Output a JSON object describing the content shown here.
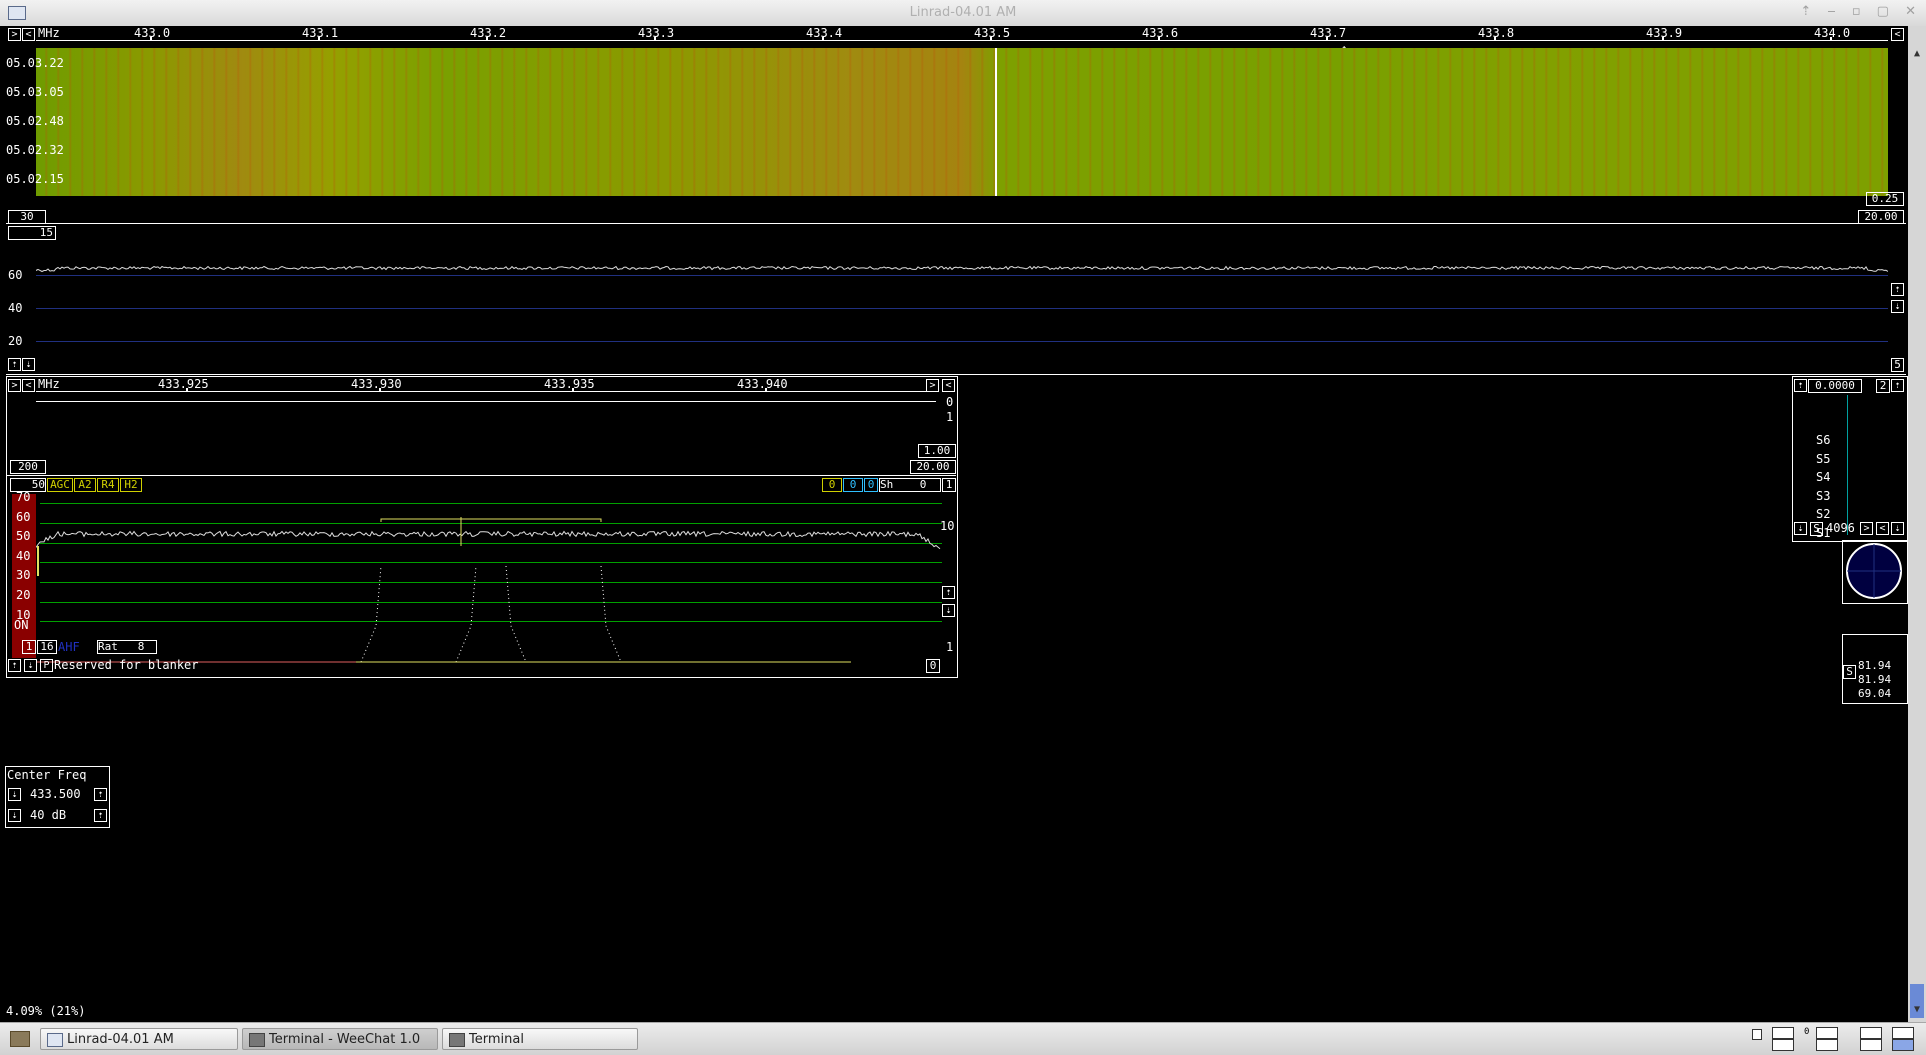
{
  "window": {
    "title": "Linrad-04.01 AM"
  },
  "top_axis": {
    "unit": "MHz",
    "ticks": [
      "433.0",
      "433.1",
      "433.2",
      "433.3",
      "433.4",
      "433.5",
      "433.6",
      "433.7",
      "433.8",
      "433.9",
      "434.0"
    ]
  },
  "waterfall": {
    "times": [
      "05.03.22",
      "05.03.05",
      "05.02.48",
      "05.02.32",
      "05.02.15"
    ],
    "right_value": "0.25",
    "left_box": "30",
    "right_box": "20.00"
  },
  "spectrum": {
    "top_box": "15",
    "levels": [
      "60",
      "40",
      "20"
    ],
    "right_box": "5"
  },
  "baseband_axis": {
    "unit": "MHz",
    "ticks": [
      "433.925",
      "433.930",
      "433.935",
      "433.940"
    ]
  },
  "baseband": {
    "right_top": [
      "0",
      "1"
    ],
    "gain_box": "1.00",
    "bw_box": "20.00",
    "left_box": "200",
    "ctrl_left": "50",
    "agc": "AGC",
    "a2": "A2",
    "r4": "R4",
    "h2": "H2",
    "ctrl_right": [
      "0",
      "0",
      "0"
    ],
    "sh_label": "Sh",
    "sh_value": "0",
    "right_1": "1",
    "right_10": "10",
    "levels": [
      "70",
      "60",
      "50",
      "40",
      "30",
      "20",
      "10"
    ],
    "on_label": "ON",
    "bottom_boxes": [
      "1",
      "16"
    ],
    "ahf": "AHF",
    "rat_label": "Rat",
    "rat_value": "8",
    "right_bottom": "1",
    "status": "Reserved for blanker",
    "status_right": "0",
    "p_label": "P"
  },
  "smeter": {
    "top_value": "0.0000",
    "top_box": "2",
    "scale": [
      "S6",
      "S5",
      "S4",
      "S3",
      "S2",
      "S1"
    ],
    "s_label": "S",
    "fft": "4096",
    "readings": [
      "81.94",
      "81.94",
      "69.04"
    ]
  },
  "center_freq": {
    "title": "Center Freq",
    "value": "433.500",
    "db": "40 dB"
  },
  "load": {
    "text": "4.09%  (21%)"
  },
  "taskbar": {
    "items": [
      "Linrad-04.01 AM",
      "Terminal - WeeChat 1.0",
      "Terminal"
    ],
    "workspace": "0"
  },
  "colors": {
    "waterfall": "#7ea000",
    "grid": "#00a000",
    "bg": "#000000"
  }
}
